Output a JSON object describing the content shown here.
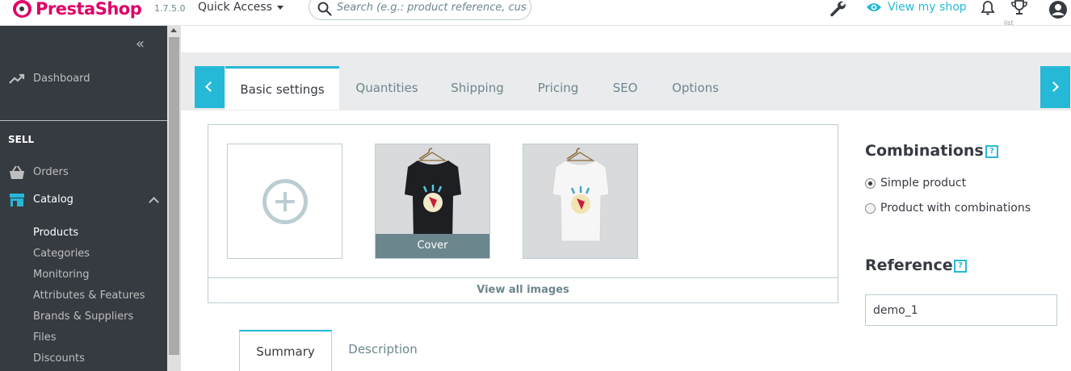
{
  "header": {
    "logo_text": "PrestaShop",
    "version": "1.7.5.0",
    "quick_access": "Quick Access",
    "search_placeholder": "Search (e.g.: product reference, custome",
    "view_my_shop": "View my shop",
    "trophy_label": "list"
  },
  "sidebar": {
    "dashboard": "Dashboard",
    "section_sell": "SELL",
    "orders": "Orders",
    "catalog": "Catalog",
    "catalog_items": [
      "Products",
      "Categories",
      "Monitoring",
      "Attributes & Features",
      "Brands & Suppliers",
      "Files",
      "Discounts"
    ]
  },
  "tabs": [
    "Basic settings",
    "Quantities",
    "Shipping",
    "Pricing",
    "SEO",
    "Options"
  ],
  "images": {
    "cover_label": "Cover",
    "view_all": "View all images"
  },
  "combinations": {
    "heading": "Combinations",
    "help": "?",
    "options": [
      "Simple product",
      "Product with combinations"
    ],
    "selected": "Simple product"
  },
  "reference": {
    "heading": "Reference",
    "help": "?",
    "value": "demo_1"
  },
  "description_tabs": [
    "Summary",
    "Description"
  ],
  "colors": {
    "accent": "#25b9d7",
    "brand": "#df0067",
    "sidebar": "#363a41"
  }
}
